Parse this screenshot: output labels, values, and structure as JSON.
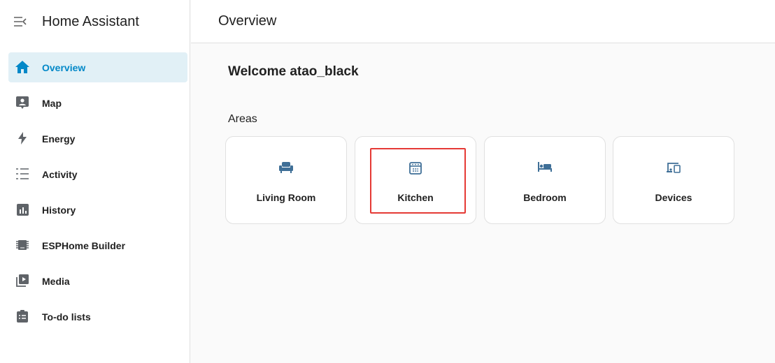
{
  "app": {
    "title": "Home Assistant"
  },
  "sidebar": {
    "items": [
      {
        "label": "Overview",
        "icon": "home-icon",
        "active": true
      },
      {
        "label": "Map",
        "icon": "map-icon"
      },
      {
        "label": "Energy",
        "icon": "lightning-icon"
      },
      {
        "label": "Activity",
        "icon": "activity-list-icon"
      },
      {
        "label": "History",
        "icon": "history-chart-icon"
      },
      {
        "label": "ESPHome Builder",
        "icon": "chip-icon"
      },
      {
        "label": "Media",
        "icon": "media-play-icon"
      },
      {
        "label": "To-do lists",
        "icon": "clipboard-list-icon"
      }
    ]
  },
  "header": {
    "title": "Overview"
  },
  "main": {
    "welcome": "Welcome atao_black",
    "areas_label": "Areas",
    "areas": [
      {
        "label": "Living Room",
        "icon": "sofa-icon"
      },
      {
        "label": "Kitchen",
        "icon": "stove-icon"
      },
      {
        "label": "Bedroom",
        "icon": "bed-icon"
      },
      {
        "label": "Devices",
        "icon": "devices-icon"
      }
    ]
  },
  "colors": {
    "accent": "#0288c8",
    "active_bg": "#e1f0f6",
    "area_icon": "#3f6f97",
    "highlight": "#e53935"
  }
}
